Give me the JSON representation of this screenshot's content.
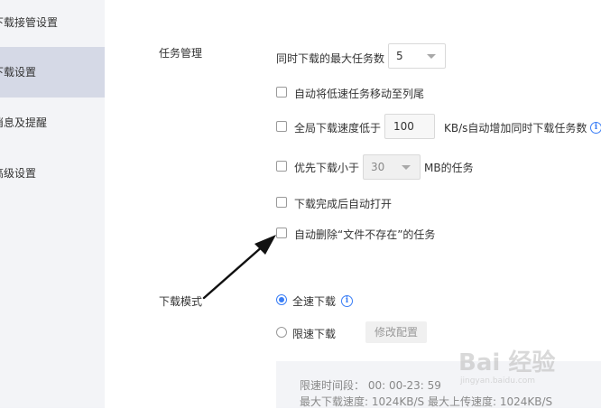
{
  "sidebar": {
    "items": [
      {
        "label": "下载接管设置",
        "active": false
      },
      {
        "label": "下载设置",
        "active": true
      },
      {
        "label": "消息及提醒",
        "active": false
      },
      {
        "label": "高级设置",
        "active": false
      }
    ]
  },
  "task_management": {
    "title": "任务管理",
    "max_tasks_label": "同时下载的最大任务数",
    "max_tasks_value": "5",
    "move_slow_label": "自动将低速任务移动至列尾",
    "speed_prefix": "全局下载速度低于",
    "speed_value": "100",
    "speed_suffix": "KB/s自动增加同时下载任务数",
    "prefer_small_prefix": "优先下载小于",
    "prefer_small_value": "30",
    "prefer_small_suffix": "MB的任务",
    "auto_open_label": "下载完成后自动打开",
    "auto_delete_label": "自动删除“文件不存在”的任务"
  },
  "download_mode": {
    "title": "下载模式",
    "full_speed_label": "全速下载",
    "limited_label": "限速下载",
    "modify_button": "修改配置",
    "limit_period": "限速时间段：  00: 00-23: 59",
    "limit_speeds": "最大下载速度: 1024KB/S    最大上传速度: 1024KB/S"
  },
  "watermark": {
    "text": "Bai  经验",
    "sub": "jingyan.baidu.com"
  },
  "colors": {
    "accent": "#3a7ef6",
    "sidebar_bg": "#f3f4f7",
    "sidebar_active": "#d5d9e6"
  }
}
